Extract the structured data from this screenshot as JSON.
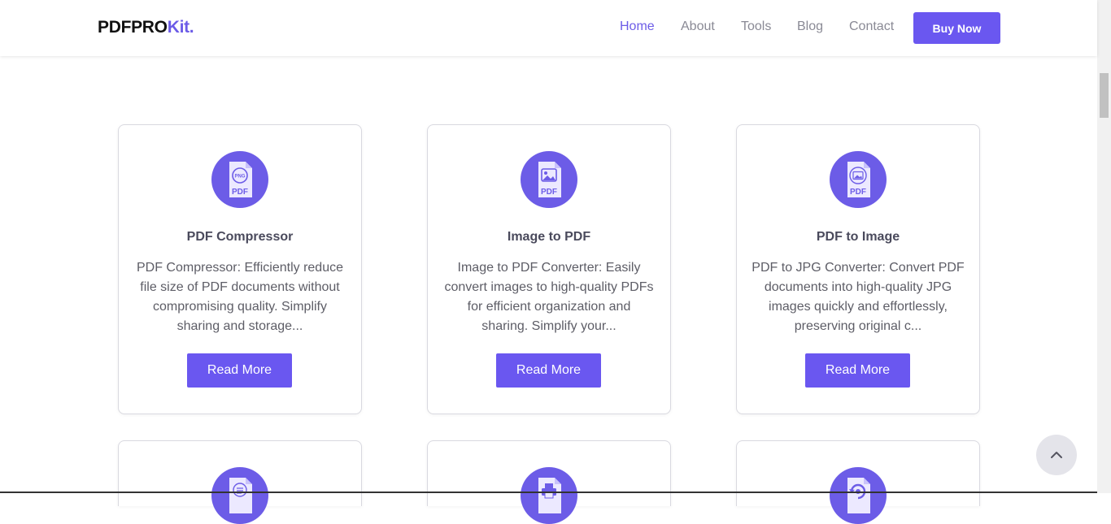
{
  "header": {
    "logo_main": "PDFPRO",
    "logo_accent": "Kit.",
    "nav": [
      {
        "label": "Home",
        "active": true
      },
      {
        "label": "About",
        "active": false
      },
      {
        "label": "Tools",
        "active": false
      },
      {
        "label": "Blog",
        "active": false
      },
      {
        "label": "Contact",
        "active": false
      }
    ],
    "buy_label": "Buy Now"
  },
  "cards": [
    {
      "icon": "png-to-pdf-icon",
      "icon_text": "PDF",
      "title": "PDF Compressor",
      "description": "PDF Compressor: Efficiently reduce file size of PDF documents without compromising quality. Simplify sharing and storage...",
      "button": "Read More"
    },
    {
      "icon": "image-to-pdf-icon",
      "icon_text": "PDF",
      "title": "Image to PDF",
      "description": "Image to PDF Converter: Easily convert images to high-quality PDFs for efficient organization and sharing. Simplify your...",
      "button": "Read More"
    },
    {
      "icon": "pdf-to-image-icon",
      "icon_text": "PDF",
      "title": "PDF to Image",
      "description": "PDF to JPG Converter: Convert PDF documents into high-quality JPG images quickly and effortlessly, preserving original c...",
      "button": "Read More"
    }
  ],
  "partial_cards": [
    {
      "icon": "document-list-icon"
    },
    {
      "icon": "print-document-icon"
    },
    {
      "icon": "rotate-document-icon"
    }
  ],
  "colors": {
    "accent": "#6c5ce7",
    "button": "#6a57f0",
    "nav_inactive": "#8a8a95"
  },
  "back_to_top_icon": "chevron-up-icon"
}
